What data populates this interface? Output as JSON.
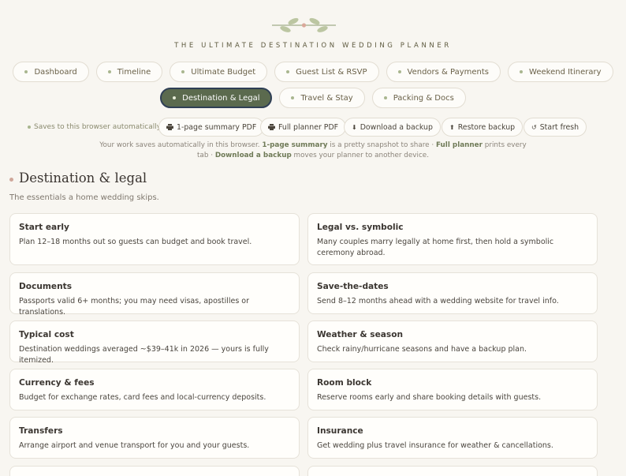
{
  "header": {
    "subtitle": "THE ULTIMATE DESTINATION WEDDING PLANNER"
  },
  "nav": {
    "row1": [
      {
        "label": "Dashboard",
        "active": false
      },
      {
        "label": "Timeline",
        "active": false
      },
      {
        "label": "Ultimate Budget",
        "active": false
      },
      {
        "label": "Guest List & RSVP",
        "active": false
      },
      {
        "label": "Vendors & Payments",
        "active": false
      },
      {
        "label": "Weekend Itinerary",
        "active": false
      }
    ],
    "row2": [
      {
        "label": "Destination & Legal",
        "active": true
      },
      {
        "label": "Travel & Stay",
        "active": false
      },
      {
        "label": "Packing & Docs",
        "active": false
      }
    ]
  },
  "toolbar": {
    "saves_text": "Saves to this browser automatically",
    "buttons": [
      {
        "label": "1-page summary PDF",
        "icon": "printer-icon"
      },
      {
        "label": "Full planner PDF",
        "icon": "printer-icon"
      },
      {
        "label": "Download a backup",
        "icon": "download-arrow-icon"
      },
      {
        "label": "Restore backup",
        "icon": "upload-arrow-icon"
      },
      {
        "label": "Start fresh",
        "icon": "refresh-icon"
      }
    ]
  },
  "help": {
    "t1": "Your work saves automatically in this browser. ",
    "b1": "1-page summary",
    "t2": " is a pretty snapshot to share · ",
    "b2": "Full planner",
    "t3": " prints every tab · ",
    "b3": "Download a backup",
    "t4": " moves your planner to another device."
  },
  "section": {
    "title": "Destination & legal",
    "subtitle": "The essentials a home wedding skips."
  },
  "cards": [
    {
      "title": "Start early",
      "body": "Plan 12–18 months out so guests can budget and book travel."
    },
    {
      "title": "Legal vs. symbolic",
      "body": "Many couples marry legally at home first, then hold a symbolic ceremony abroad."
    },
    {
      "title": "Documents",
      "body": "Passports valid 6+ months; you may need visas, apostilles or translations."
    },
    {
      "title": "Save-the-dates",
      "body": "Send 8–12 months ahead with a wedding website for travel info."
    },
    {
      "title": "Typical cost",
      "body": "Destination weddings averaged ~$39–41k in 2026 — yours is fully itemized."
    },
    {
      "title": "Weather & season",
      "body": "Check rainy/hurricane seasons and have a backup plan."
    },
    {
      "title": "Currency & fees",
      "body": "Budget for exchange rates, card fees and local-currency deposits."
    },
    {
      "title": "Room block",
      "body": "Reserve rooms early and share booking details with guests."
    },
    {
      "title": "Transfers",
      "body": "Arrange airport and venue transport for you and your guests."
    },
    {
      "title": "Insurance",
      "body": "Get wedding plus travel insurance for weather & cancellations."
    },
    {
      "title": "",
      "body": ""
    },
    {
      "title": "",
      "body": ""
    }
  ],
  "colors": {
    "background": "#f8f6f1",
    "accent_green": "#5b6a4e",
    "active_border": "#2f3f55",
    "leaf_green": "#a9b68f",
    "rose_dot": "#cfa79a"
  }
}
